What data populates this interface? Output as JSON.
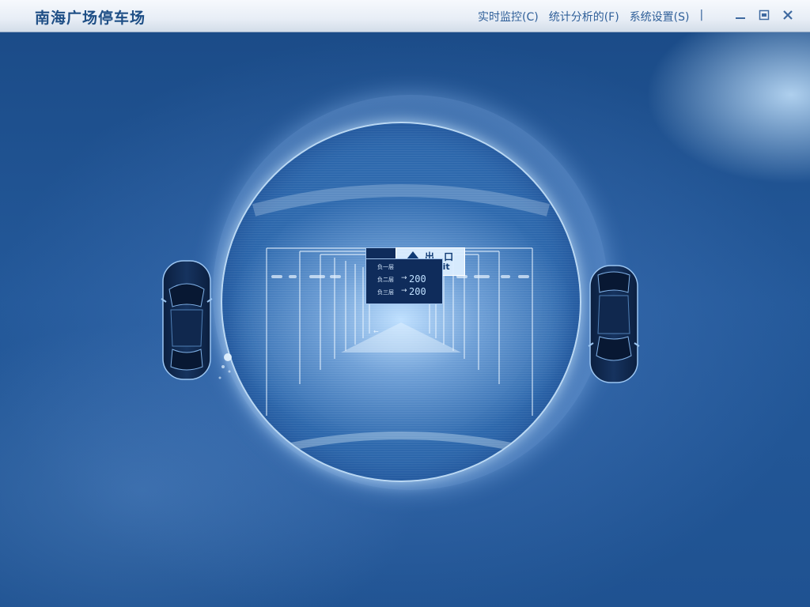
{
  "app": {
    "title": "南海广场停车场"
  },
  "menu": {
    "items": [
      {
        "label": "实时监控(C)"
      },
      {
        "label": "统计分析的(F)"
      },
      {
        "label": "系统设置(S)"
      }
    ],
    "separator": "|"
  },
  "window_controls": {
    "minimize_glyph": "—",
    "maximize_glyph": "▣",
    "close_glyph": "✕"
  },
  "signage": {
    "exit_cn": "出 口",
    "exit_en": "Exit",
    "levels": [
      {
        "name": "负一层",
        "count": ""
      },
      {
        "name": "负二层",
        "count": "200"
      },
      {
        "name": "负三层",
        "count": "200"
      }
    ],
    "bottom_left_arrow": "←"
  },
  "colors": {
    "accent": "#1f4f86",
    "background": "#1c4d88",
    "glow": "#bfe0ff"
  },
  "icons": {
    "car_left": "car-top-view-icon",
    "car_right": "car-top-view-icon",
    "minimize": "minimize-icon",
    "maximize": "maximize-icon",
    "close": "close-icon",
    "exit_arrow": "arrow-up-icon"
  }
}
